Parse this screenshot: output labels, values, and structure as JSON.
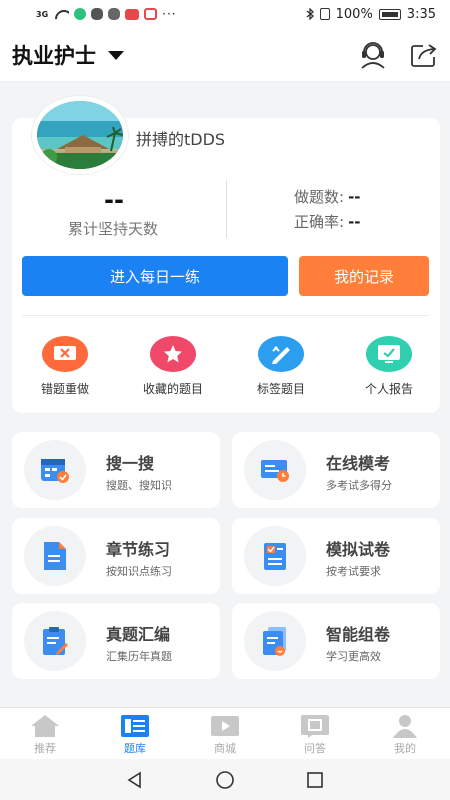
{
  "status_bar": {
    "signal": "3G",
    "battery": "100%",
    "time": "3:35",
    "overflow": "···"
  },
  "header": {
    "title": "执业护士",
    "icons": [
      "customer-service-icon",
      "share-icon"
    ]
  },
  "profile": {
    "username": "拼搏的tDDS",
    "days_value": "--",
    "days_label": "累计坚持天数",
    "questions_label": "做题数:",
    "questions_value": "--",
    "accuracy_label": "正确率:",
    "accuracy_value": "--",
    "daily_button": "进入每日一练",
    "record_button": "我的记录"
  },
  "quick_actions": [
    {
      "label": "错题重做",
      "icon": "wrong-redo-icon",
      "color": "#ff6a3d"
    },
    {
      "label": "收藏的题目",
      "icon": "star-icon",
      "color": "#f04868"
    },
    {
      "label": "标签题目",
      "icon": "tag-pencil-icon",
      "color": "#2b9ef0"
    },
    {
      "label": "个人报告",
      "icon": "report-icon",
      "color": "#2fcfb0"
    }
  ],
  "features": [
    {
      "title": "搜一搜",
      "subtitle": "搜题、搜知识",
      "icon": "calendar-search-icon"
    },
    {
      "title": "在线模考",
      "subtitle": "多考试多得分",
      "icon": "online-exam-icon"
    },
    {
      "title": "章节练习",
      "subtitle": "按知识点练习",
      "icon": "chapter-doc-icon"
    },
    {
      "title": "模拟试卷",
      "subtitle": "按考试要求",
      "icon": "mock-paper-icon"
    },
    {
      "title": "真题汇编",
      "subtitle": "汇集历年真题",
      "icon": "clipboard-edit-icon"
    },
    {
      "title": "智能组卷",
      "subtitle": "学习更高效",
      "icon": "smart-paper-icon"
    }
  ],
  "bottom_nav": [
    {
      "label": "推荐",
      "icon": "home-icon",
      "active": false
    },
    {
      "label": "题库",
      "icon": "question-bank-icon",
      "active": true
    },
    {
      "label": "商城",
      "icon": "video-store-icon",
      "active": false
    },
    {
      "label": "问答",
      "icon": "qa-icon",
      "active": false
    },
    {
      "label": "我的",
      "icon": "user-icon",
      "active": false
    }
  ],
  "colors": {
    "primary": "#1a82f3",
    "accent": "#ff7f3a",
    "icon_blue": "#3b8df2"
  }
}
